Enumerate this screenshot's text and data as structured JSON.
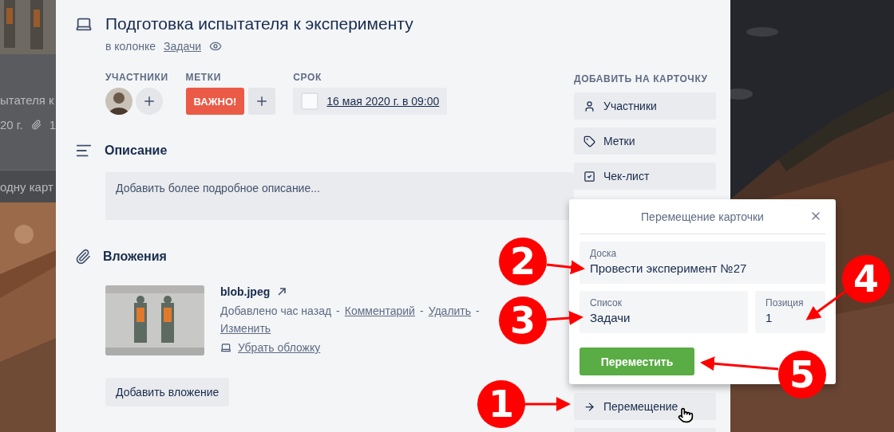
{
  "board_background": {
    "card_title_fragment": "ытателя к",
    "card_date_fragment": "20 г.",
    "card_attachments_fragment": "1",
    "add_card_fragment": "одну карт"
  },
  "card": {
    "title": "Подготовка испытателя к эксперименту",
    "list_prefix": "в колонке",
    "list_name": "Задачи",
    "members": {
      "label": "УЧАСТНИКИ"
    },
    "labels": {
      "label": "МЕТКИ",
      "items": [
        {
          "text": "ВАЖНО!",
          "color": "#eb5a46"
        }
      ]
    },
    "due": {
      "label": "СРОК",
      "date": "16 мая 2020 г. в 09:00",
      "checked": false
    },
    "description": {
      "title": "Описание",
      "placeholder": "Добавить более подробное описание..."
    },
    "attachments": {
      "title": "Вложения",
      "items": [
        {
          "name": "blob.jpeg",
          "added": "Добавлено час назад",
          "separator": "-",
          "actions": [
            "Комментарий",
            "Удалить",
            "Изменить"
          ],
          "cover_action": "Убрать обложку"
        }
      ],
      "add_button": "Добавить вложение"
    }
  },
  "sidebar": {
    "title": "ДОБАВИТЬ НА КАРТОЧКУ",
    "buttons": [
      {
        "kind": "members",
        "label": "Участники"
      },
      {
        "kind": "labels",
        "label": "Метки"
      },
      {
        "kind": "checklist",
        "label": "Чек-лист"
      }
    ],
    "move_button": {
      "label": "Перемещение"
    }
  },
  "move_popover": {
    "title": "Перемещение карточки",
    "board": {
      "label": "Доска",
      "value": "Провести эксперимент №27"
    },
    "list": {
      "label": "Список",
      "value": "Задачи"
    },
    "position": {
      "label": "Позиция",
      "value": "1"
    },
    "submit": "Переместить"
  },
  "annotations": [
    {
      "number": "1"
    },
    {
      "number": "2"
    },
    {
      "number": "3"
    },
    {
      "number": "4"
    },
    {
      "number": "5"
    }
  ]
}
